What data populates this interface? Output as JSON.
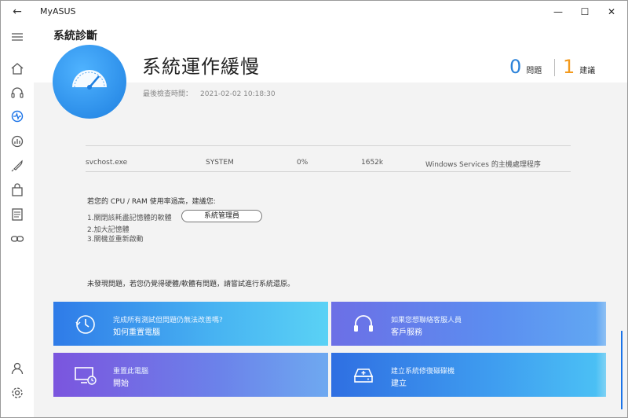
{
  "app": {
    "title": "MyASUS"
  },
  "window_controls": {
    "back": "←",
    "minimize": "—",
    "maximize": "☐",
    "close": "✕"
  },
  "sidebar": {
    "items": [
      {
        "icon": "menu-icon"
      },
      {
        "icon": "home-icon"
      },
      {
        "icon": "headset-icon"
      },
      {
        "icon": "diagnosis-icon"
      },
      {
        "icon": "performance-icon"
      },
      {
        "icon": "rocket-icon"
      },
      {
        "icon": "bag-icon"
      },
      {
        "icon": "news-icon"
      },
      {
        "icon": "link-icon"
      },
      {
        "icon": "user-icon"
      },
      {
        "icon": "gear-icon"
      }
    ]
  },
  "page": {
    "title": "系統診斷",
    "status_title": "系統運作緩慢",
    "last_check_label": "最後檢查時間：",
    "last_check_time": "2021-02-02 10:18:30"
  },
  "counts": {
    "issues_value": "0",
    "issues_label": "問題",
    "suggestions_value": "1",
    "suggestions_label": "建議",
    "issues_color": "#2b82d9",
    "suggestions_color": "#f39a1d"
  },
  "process": {
    "name": "svchost.exe",
    "user": "SYSTEM",
    "cpu": "0%",
    "memory": "1652k",
    "description": "Windows Services 的主機處理程序"
  },
  "advice": {
    "intro": "若您的 CPU / RAM 使用率過高，建議您:",
    "step1": "1.關閉該耗盡記憶體的軟體",
    "step2": "2.加大記憶體",
    "step3": "3.關機並重新啟動",
    "task_manager_button": "系統管理員"
  },
  "no_issue_text": "未發現問題，若您仍覺得硬體/軟體有問題，請嘗試進行系統還原。",
  "cards": [
    {
      "sub": "完成所有測試但問題仍無法改善嗎?",
      "main": "如何重置電腦",
      "icon": "clock-reset-icon"
    },
    {
      "sub": "如果您想聯絡客服人員",
      "main": "客戶服務",
      "icon": "headset-icon"
    },
    {
      "sub": "重置此電腦",
      "main": "開始",
      "icon": "monitor-reset-icon"
    },
    {
      "sub": "建立系統修復磁碟機",
      "main": "建立",
      "icon": "drive-icon"
    }
  ]
}
